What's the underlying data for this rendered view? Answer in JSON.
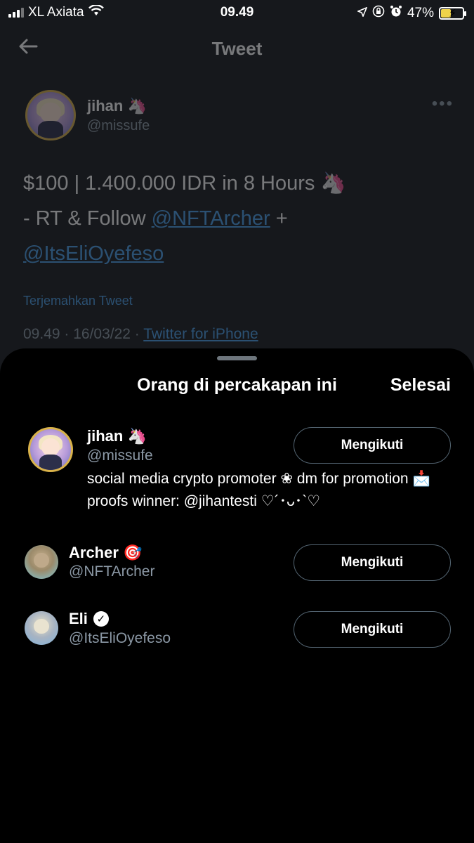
{
  "status_bar": {
    "carrier": "XL Axiata",
    "time": "09.49",
    "battery_percent": "47%",
    "battery_level": 0.47
  },
  "nav": {
    "back_icon": "arrow-left-icon",
    "title": "Tweet"
  },
  "tweet": {
    "author_name": "jihan 🦄",
    "author_handle": "@missufe",
    "more_icon": "more-dots-icon",
    "line1": "$100 | 1.400.000 IDR in 8 Hours 🦄",
    "line2_prefix": "- RT & Follow ",
    "mention1": "@NFTArcher",
    "line2_suffix": " +",
    "mention2": "@ItsEliOyefeso",
    "translate_label": "Terjemahkan Tweet",
    "timestamp": "09.49 · 16/03/22 · ",
    "source": "Twitter for iPhone"
  },
  "sheet": {
    "title": "Orang di percakapan ini",
    "done_label": "Selesai",
    "people": [
      {
        "name": "jihan 🦄",
        "handle": "@missufe",
        "button": "Mengikuti",
        "bio": "social media crypto promoter ❀ dm for promotion 📩 proofs winner: @jihantesti ♡´･ᴗ･`♡"
      },
      {
        "name": "Archer 🎯",
        "handle": "@NFTArcher",
        "button": "Mengikuti"
      },
      {
        "name": "Eli",
        "handle": "@ItsEliOyefeso",
        "button": "Mengikuti",
        "verified_icon": "verified-badge-icon"
      }
    ]
  },
  "colors": {
    "link": "#4a9fe8",
    "secondary_text": "#8b98a5",
    "battery_fill": "#f0d34a"
  }
}
